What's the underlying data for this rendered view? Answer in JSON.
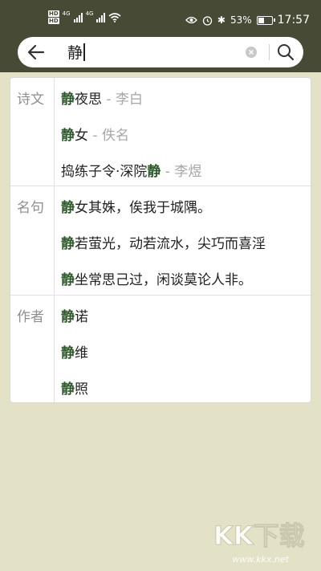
{
  "status_bar": {
    "network_badges": [
      "HD",
      "HD"
    ],
    "signal_tags": [
      "4G",
      "4G"
    ],
    "battery_percent": "53%",
    "bluetooth_battery": "✱",
    "time": "17:57",
    "battery_level": 0.53
  },
  "search": {
    "query": "静",
    "icons": {
      "back": "arrow-left-icon",
      "clear": "clear-circle-icon",
      "search": "magnifier-icon"
    }
  },
  "sections": [
    {
      "label": "诗文",
      "items": [
        {
          "hl": "静",
          "pre": "",
          "post": "夜思",
          "sep": " - ",
          "author": "李白"
        },
        {
          "hl": "静",
          "pre": "",
          "post": "女",
          "sep": " - ",
          "author": "佚名"
        },
        {
          "hl": "静",
          "pre": "捣练子令·深院",
          "post": "",
          "sep": " - ",
          "author": "李煜"
        }
      ]
    },
    {
      "label": "名句",
      "items": [
        {
          "hl": "静",
          "post": "女其姝，俟我于城隅。"
        },
        {
          "hl": "静",
          "post": "若萤光，动若流水，尖巧而喜淫"
        },
        {
          "hl": "静",
          "post": "坐常思己过，闲谈莫论人非。"
        }
      ]
    },
    {
      "label": "作者",
      "items": [
        {
          "hl": "静",
          "post": "诺"
        },
        {
          "hl": "静",
          "post": "维"
        },
        {
          "hl": "静",
          "post": "照"
        }
      ]
    }
  ],
  "watermark": {
    "logo_text": "KK下载",
    "url": "www.kkx.net"
  },
  "colors": {
    "toolbar": "#474b35",
    "background": "#e3e1c6",
    "highlight": "#2f5a2b",
    "muted": "#a6a6a6"
  }
}
